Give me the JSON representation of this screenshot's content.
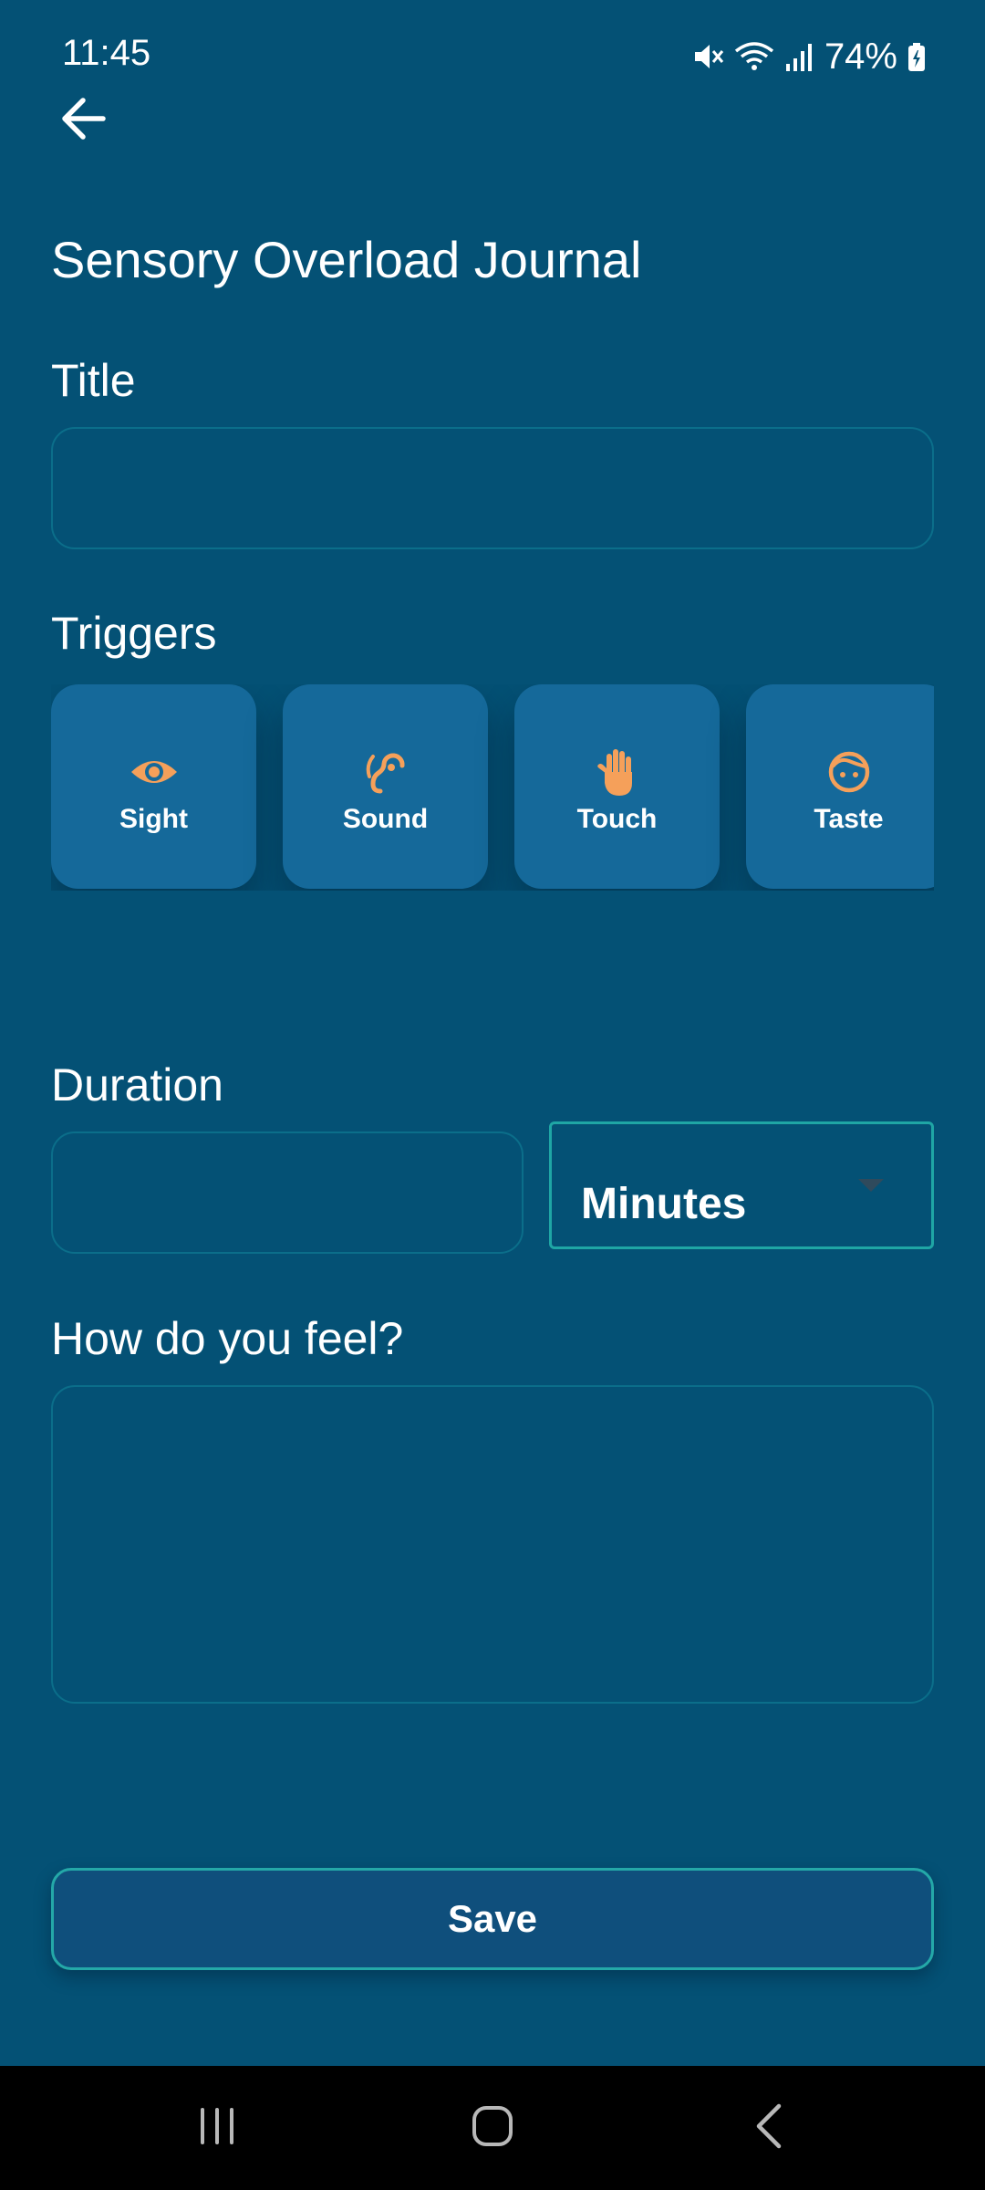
{
  "status_bar": {
    "time": "11:45",
    "battery": "74%",
    "icons": [
      "mute-icon",
      "wifi-icon",
      "signal-icon",
      "battery-icon"
    ]
  },
  "header": {
    "back_icon": "arrow-left-icon",
    "title": "Sensory Overload Journal"
  },
  "form": {
    "title_label": "Title",
    "title_value": "",
    "triggers_label": "Triggers",
    "triggers": [
      {
        "label": "Sight",
        "icon": "eye-icon"
      },
      {
        "label": "Sound",
        "icon": "ear-icon"
      },
      {
        "label": "Touch",
        "icon": "hand-icon"
      },
      {
        "label": "Taste",
        "icon": "face-icon"
      }
    ],
    "duration_label": "Duration",
    "duration_value": "",
    "duration_unit": "Minutes",
    "feel_label": "How do you feel?",
    "feel_value": "",
    "save_label": "Save"
  },
  "nav_bar": {
    "icons": [
      "recents-icon",
      "home-icon",
      "back-icon"
    ]
  },
  "colors": {
    "background": "#045175",
    "card": "#15699a",
    "accent_icon": "#f5a05a",
    "field_border": "#0b6e8a",
    "focus_border": "#1fa6a5"
  }
}
